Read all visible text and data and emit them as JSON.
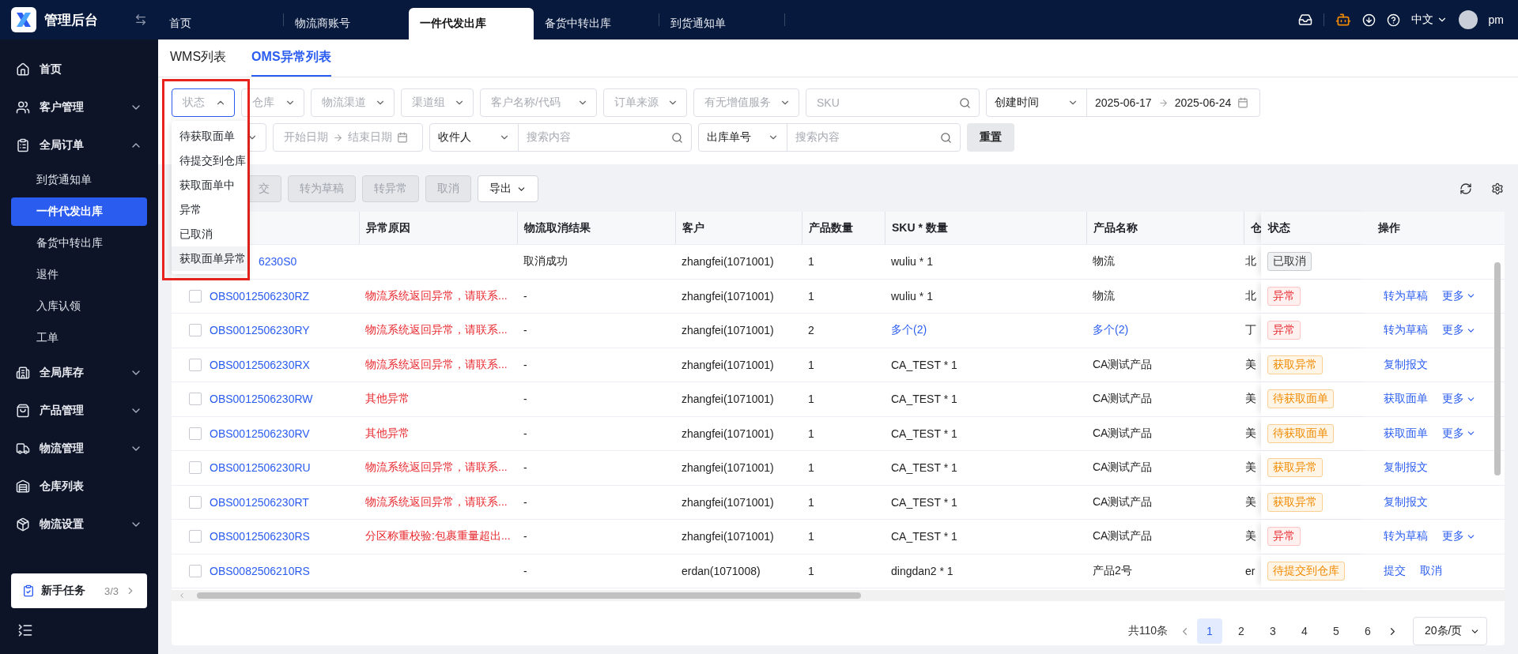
{
  "app": {
    "title": "管理后台"
  },
  "nav_tabs": [
    {
      "label": "首页",
      "selected": false
    },
    {
      "label": "物流商账号",
      "selected": false
    },
    {
      "label": "一件代发出库",
      "selected": true
    },
    {
      "label": "备货中转出库",
      "selected": false
    },
    {
      "label": "到货通知单",
      "selected": false
    }
  ],
  "header_actions": {
    "language": "中文",
    "user": "pm"
  },
  "sidebar": {
    "items": [
      {
        "label": "首页"
      },
      {
        "label": "客户管理",
        "expanded": false
      },
      {
        "label": "全局订单",
        "expanded": true,
        "children": [
          {
            "label": "到货通知单",
            "selected": false
          },
          {
            "label": "一件代发出库",
            "selected": true
          },
          {
            "label": "备货中转出库",
            "selected": false
          },
          {
            "label": "退件",
            "selected": false
          },
          {
            "label": "入库认领",
            "selected": false
          },
          {
            "label": "工单",
            "selected": false
          }
        ]
      },
      {
        "label": "全局库存",
        "expanded": false
      },
      {
        "label": "产品管理",
        "expanded": false
      },
      {
        "label": "物流管理",
        "expanded": false
      },
      {
        "label": "仓库列表"
      },
      {
        "label": "物流设置",
        "expanded": false
      }
    ],
    "task_card": {
      "label": "新手任务",
      "progress": "3/3"
    }
  },
  "sub_tabs": [
    {
      "label": "WMS列表",
      "selected": false
    },
    {
      "label": "OMS异常列表",
      "selected": true
    }
  ],
  "filters": {
    "row_1": [
      {
        "kind": "select",
        "placeholder": "状态",
        "open": true
      },
      {
        "kind": "select",
        "placeholder": "仓库",
        "open": false
      },
      {
        "kind": "select",
        "placeholder": "物流渠道",
        "open": false
      },
      {
        "kind": "select",
        "placeholder": "渠道组",
        "open": false
      },
      {
        "kind": "select",
        "placeholder": "客户名称/代码",
        "open": false
      },
      {
        "kind": "select",
        "placeholder": "订单来源",
        "open": false
      },
      {
        "kind": "select",
        "placeholder": "有无增值服务",
        "open": false
      },
      {
        "kind": "search",
        "placeholder": "SKU"
      },
      {
        "kind": "date_select",
        "value": "创建时间",
        "start": "2025-06-17",
        "end": "2025-06-24"
      }
    ],
    "row_2": [
      {
        "kind": "select",
        "open": false
      },
      {
        "kind": "date_range",
        "start_placeholder": "开始日期",
        "end_placeholder": "结束日期"
      },
      {
        "kind": "select_search",
        "value": "收件人",
        "placeholder": "搜索内容"
      },
      {
        "kind": "select_search",
        "value": "出库单号",
        "placeholder": "搜索内容"
      },
      {
        "kind": "button",
        "label": "重置"
      }
    ]
  },
  "status_dropdown": {
    "options": [
      {
        "label": "待获取面单",
        "selected": false
      },
      {
        "label": "待提交到仓库",
        "selected": false
      },
      {
        "label": "获取面单中",
        "selected": false
      },
      {
        "label": "异常",
        "selected": false
      },
      {
        "label": "已取消",
        "selected": false
      },
      {
        "label": "获取面单异常",
        "selected": true
      }
    ]
  },
  "toolbar": {
    "buttons": [
      {
        "label": "交",
        "disabled": true,
        "dropdown": false,
        "covered": true
      },
      {
        "label": "转为草稿",
        "disabled": true,
        "dropdown": false
      },
      {
        "label": "转异常",
        "disabled": true,
        "dropdown": false
      },
      {
        "label": "取消",
        "disabled": true,
        "dropdown": false
      },
      {
        "label": "导出",
        "disabled": false,
        "dropdown": true
      }
    ]
  },
  "table": {
    "columns": [
      "异常原因",
      "物流取消结果",
      "客户",
      "产品数量",
      "SKU * 数量",
      "产品名称",
      "仓",
      "状态",
      "操作"
    ],
    "rows": [
      {
        "order_no": "6230S0",
        "reason": "",
        "cancel_result": "取消成功",
        "customer": "zhangfei(1071001)",
        "qty": "1",
        "sku": {
          "text": "wuliu * 1",
          "link": false
        },
        "product": {
          "text": "物流",
          "link": false
        },
        "warehouse": "北",
        "status": {
          "text": "已取消",
          "kind": "neutral"
        },
        "actions": []
      },
      {
        "checked": false,
        "order_no": "OBS0012506230RZ",
        "reason": "物流系统返回异常，请联系...",
        "cancel_result": "-",
        "customer": "zhangfei(1071001)",
        "qty": "1",
        "sku": {
          "text": "wuliu * 1",
          "link": false
        },
        "product": {
          "text": "物流",
          "link": false
        },
        "warehouse": "北",
        "status": {
          "text": "异常",
          "kind": "error"
        },
        "actions": [
          {
            "label": "转为草稿",
            "dropdown": false
          },
          {
            "label": "更多",
            "dropdown": true
          }
        ]
      },
      {
        "checked": false,
        "order_no": "OBS0012506230RY",
        "reason": "物流系统返回异常，请联系...",
        "cancel_result": "-",
        "customer": "zhangfei(1071001)",
        "qty": "2",
        "sku": {
          "text": "多个(2)",
          "link": true
        },
        "product": {
          "text": "多个(2)",
          "link": true
        },
        "warehouse": "丁",
        "status": {
          "text": "异常",
          "kind": "error"
        },
        "actions": [
          {
            "label": "转为草稿",
            "dropdown": false
          },
          {
            "label": "更多",
            "dropdown": true
          }
        ]
      },
      {
        "checked": false,
        "order_no": "OBS0012506230RX",
        "reason": "物流系统返回异常，请联系...",
        "cancel_result": "-",
        "customer": "zhangfei(1071001)",
        "qty": "1",
        "sku": {
          "text": "CA_TEST * 1",
          "link": false
        },
        "product": {
          "text": "CA测试产品",
          "link": false
        },
        "warehouse": "美",
        "status": {
          "text": "获取异常",
          "kind": "warning"
        },
        "actions": [
          {
            "label": "复制报文",
            "dropdown": false
          }
        ]
      },
      {
        "checked": false,
        "order_no": "OBS0012506230RW",
        "reason": "其他异常",
        "cancel_result": "-",
        "customer": "zhangfei(1071001)",
        "qty": "1",
        "sku": {
          "text": "CA_TEST * 1",
          "link": false
        },
        "product": {
          "text": "CA测试产品",
          "link": false
        },
        "warehouse": "美",
        "status": {
          "text": "待获取面单",
          "kind": "warning"
        },
        "actions": [
          {
            "label": "获取面单",
            "dropdown": false
          },
          {
            "label": "更多",
            "dropdown": true
          }
        ]
      },
      {
        "checked": false,
        "order_no": "OBS0012506230RV",
        "reason": "其他异常",
        "cancel_result": "-",
        "customer": "zhangfei(1071001)",
        "qty": "1",
        "sku": {
          "text": "CA_TEST * 1",
          "link": false
        },
        "product": {
          "text": "CA测试产品",
          "link": false
        },
        "warehouse": "美",
        "status": {
          "text": "待获取面单",
          "kind": "warning"
        },
        "actions": [
          {
            "label": "获取面单",
            "dropdown": false
          },
          {
            "label": "更多",
            "dropdown": true
          }
        ]
      },
      {
        "checked": false,
        "order_no": "OBS0012506230RU",
        "reason": "物流系统返回异常，请联系...",
        "cancel_result": "-",
        "customer": "zhangfei(1071001)",
        "qty": "1",
        "sku": {
          "text": "CA_TEST * 1",
          "link": false
        },
        "product": {
          "text": "CA测试产品",
          "link": false
        },
        "warehouse": "美",
        "status": {
          "text": "获取异常",
          "kind": "warning"
        },
        "actions": [
          {
            "label": "复制报文",
            "dropdown": false
          }
        ]
      },
      {
        "checked": false,
        "order_no": "OBS0012506230RT",
        "reason": "物流系统返回异常，请联系...",
        "cancel_result": "-",
        "customer": "zhangfei(1071001)",
        "qty": "1",
        "sku": {
          "text": "CA_TEST * 1",
          "link": false
        },
        "product": {
          "text": "CA测试产品",
          "link": false
        },
        "warehouse": "美",
        "status": {
          "text": "获取异常",
          "kind": "warning"
        },
        "actions": [
          {
            "label": "复制报文",
            "dropdown": false
          }
        ]
      },
      {
        "checked": false,
        "order_no": "OBS0012506230RS",
        "reason": "分区称重校验:包裹重量超出...",
        "cancel_result": "-",
        "customer": "zhangfei(1071001)",
        "qty": "1",
        "sku": {
          "text": "CA_TEST * 1",
          "link": false
        },
        "product": {
          "text": "CA测试产品",
          "link": false
        },
        "warehouse": "美",
        "status": {
          "text": "异常",
          "kind": "error"
        },
        "actions": [
          {
            "label": "转为草稿",
            "dropdown": false
          },
          {
            "label": "更多",
            "dropdown": true
          }
        ]
      },
      {
        "checked": false,
        "order_no": "OBS0082506210RS",
        "reason": "",
        "cancel_result": "-",
        "customer": "erdan(1071008)",
        "qty": "1",
        "sku": {
          "text": "dingdan2 * 1",
          "link": false
        },
        "product": {
          "text": "产品2号",
          "link": false
        },
        "warehouse": "er",
        "status": {
          "text": "待提交到仓库",
          "kind": "warning"
        },
        "actions": [
          {
            "label": "提交",
            "dropdown": false
          },
          {
            "label": "取消",
            "dropdown": false
          }
        ]
      }
    ]
  },
  "pagination": {
    "total": "共110条",
    "pages": [
      {
        "label": "1",
        "selected": true
      },
      {
        "label": "2",
        "selected": false
      },
      {
        "label": "3",
        "selected": false
      },
      {
        "label": "4",
        "selected": false
      },
      {
        "label": "5",
        "selected": false
      },
      {
        "label": "6",
        "selected": false
      }
    ],
    "page_size": "20条/页"
  }
}
